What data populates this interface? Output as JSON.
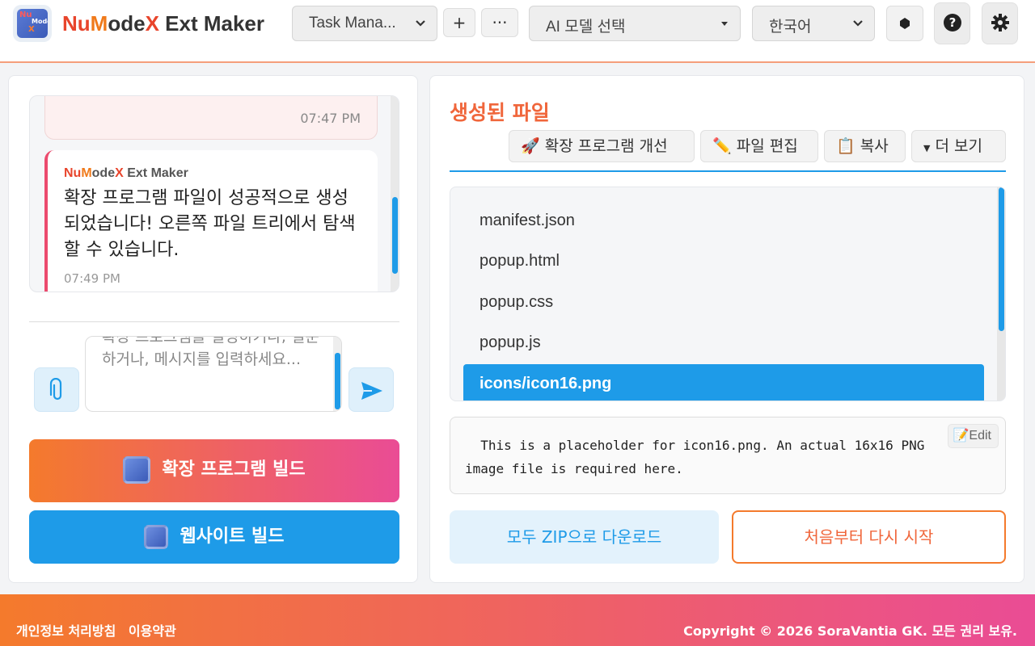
{
  "header": {
    "brand_nu": "Nu",
    "brand_mode": "M",
    "brand_ode": "ode",
    "brand_x": "X",
    "brand_rest": " Ext Maker",
    "project_select": "Task Mana...",
    "add_label": "+",
    "more_label": "···",
    "model_select": "AI 모델 선택",
    "language_select": "한국어"
  },
  "chat": {
    "user_time": "07:47 PM",
    "bot_sender_nu": "Nu",
    "bot_sender_m": "M",
    "bot_sender_ode": "ode",
    "bot_sender_x": "X",
    "bot_sender_rest": " Ext Maker",
    "bot_text": "확장 프로그램 파일이 성공적으로 생성되었습니다! 오른쪽 파일 트리에서 탐색할 수 있습니다.",
    "bot_time": "07:49 PM"
  },
  "input": {
    "placeholder": "확장 프로그램을 설명하거나, 질문하거나, 메시지를 입력하세요..."
  },
  "actions": {
    "build_extension": "확장 프로그램 빌드",
    "build_website": "웹사이트 빌드"
  },
  "files_panel": {
    "title": "생성된 파일",
    "improve_label": "확장 프로그램 개선",
    "edit_label": "파일 편집",
    "copy_label": "복사",
    "more_label": "더 보기",
    "files": [
      "manifest.json",
      "popup.html",
      "popup.css",
      "popup.js",
      "icons/icon16.png"
    ],
    "selected_file": "icons/icon16.png",
    "preview_text": "  This is a placeholder for icon16.png. An actual 16x16 PNG\nimage file is required here.",
    "preview_edit": "Edit",
    "download_zip": "모두 ZIP으로 다운로드",
    "restart": "처음부터 다시 시작"
  },
  "footer": {
    "privacy": "개인정보 처리방침",
    "terms": "이용약관",
    "copyright": "Copyright © 2026 SoraVantia GK. 모든 권리 보유."
  },
  "colors": {
    "accent_blue": "#1e9be8",
    "accent_orange": "#f47a2c",
    "accent_pink": "#ea4c95",
    "title_orange": "#f0663b"
  }
}
